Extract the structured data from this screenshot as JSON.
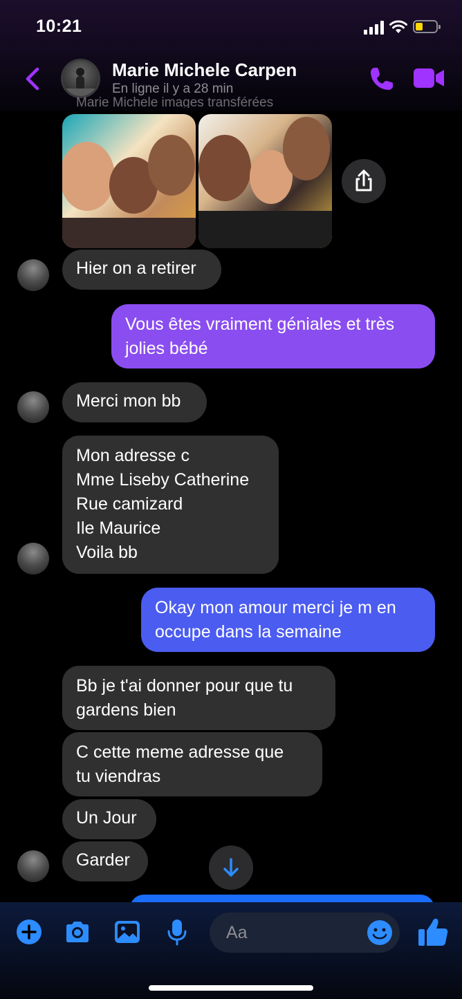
{
  "status_bar": {
    "time": "10:21"
  },
  "header": {
    "contact_name": "Marie Michele Carpen",
    "contact_status": "En ligne il y a 28 min"
  },
  "system_note": "Marie Michele images transférées",
  "messages": [
    {
      "sender": "them",
      "text": "Hier on a retirer"
    },
    {
      "sender": "me",
      "text": "Vous êtes vraiment géniales et très\njolies bébé"
    },
    {
      "sender": "them",
      "text": "Merci mon bb"
    },
    {
      "sender": "them",
      "text": "Mon adresse c\nMme Liseby Catherine\nRue camizard\nIle  Maurice\nVoila bb"
    },
    {
      "sender": "me",
      "text": "Okay mon amour merci je m en\noccupe dans la semaine"
    },
    {
      "sender": "them",
      "text": "Bb je t'ai donner pour que tu\ngardens bien"
    },
    {
      "sender": "them",
      "text": "C cette meme adresse que\ntu viendras"
    },
    {
      "sender": "them",
      "text": "Un Jour"
    },
    {
      "sender": "them",
      "text": "Garder"
    }
  ],
  "composer": {
    "placeholder": "Aa"
  },
  "colors": {
    "accent": "#a033ff",
    "toolbar_blue": "#2d8cff",
    "outgoing_purple": "#8a4df0",
    "outgoing_blue": "#4b5cf0",
    "incoming": "#303030"
  }
}
